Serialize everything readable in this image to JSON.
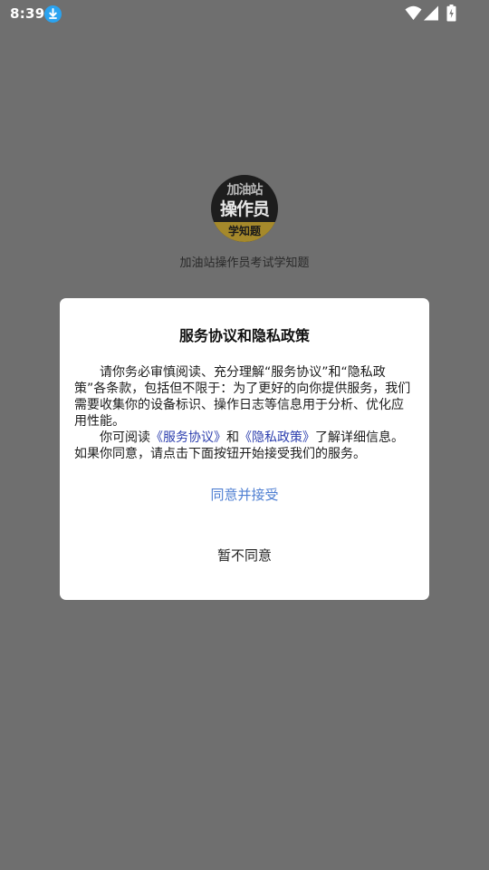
{
  "status_bar": {
    "time": "8:39",
    "icons": [
      "download-icon",
      "wifi-icon",
      "signal-icon",
      "battery-icon"
    ]
  },
  "splash": {
    "logo": {
      "top_text": "加油站",
      "mid_text": "操作员",
      "bottom_text": "学知题"
    },
    "app_name": "加油站操作员考试学知题"
  },
  "dialog": {
    "title": "服务协议和隐私政策",
    "paragraph1": "请你务必审慎阅读、充分理解“服务协议”和“隐私政策”各条款，包括但不限于：为了更好的向你提供服务，我们需要收集你的设备标识、操作日志等信息用于分析、优化应用性能。",
    "paragraph2_prefix": "你可阅读",
    "service_link": "《服务协议》",
    "paragraph2_and": "和",
    "privacy_link": "《隐私政策》",
    "paragraph2_suffix": "了解详细信息。如果你同意，请点击下面按钮开始接受我们的服务。",
    "agree_label": "同意并接受",
    "disagree_label": "暂不同意"
  },
  "colors": {
    "overlay": "#6f6f6f",
    "link": "#2d3fae",
    "agree": "#4f7fd2",
    "download_badge": "#2aa3f0"
  }
}
